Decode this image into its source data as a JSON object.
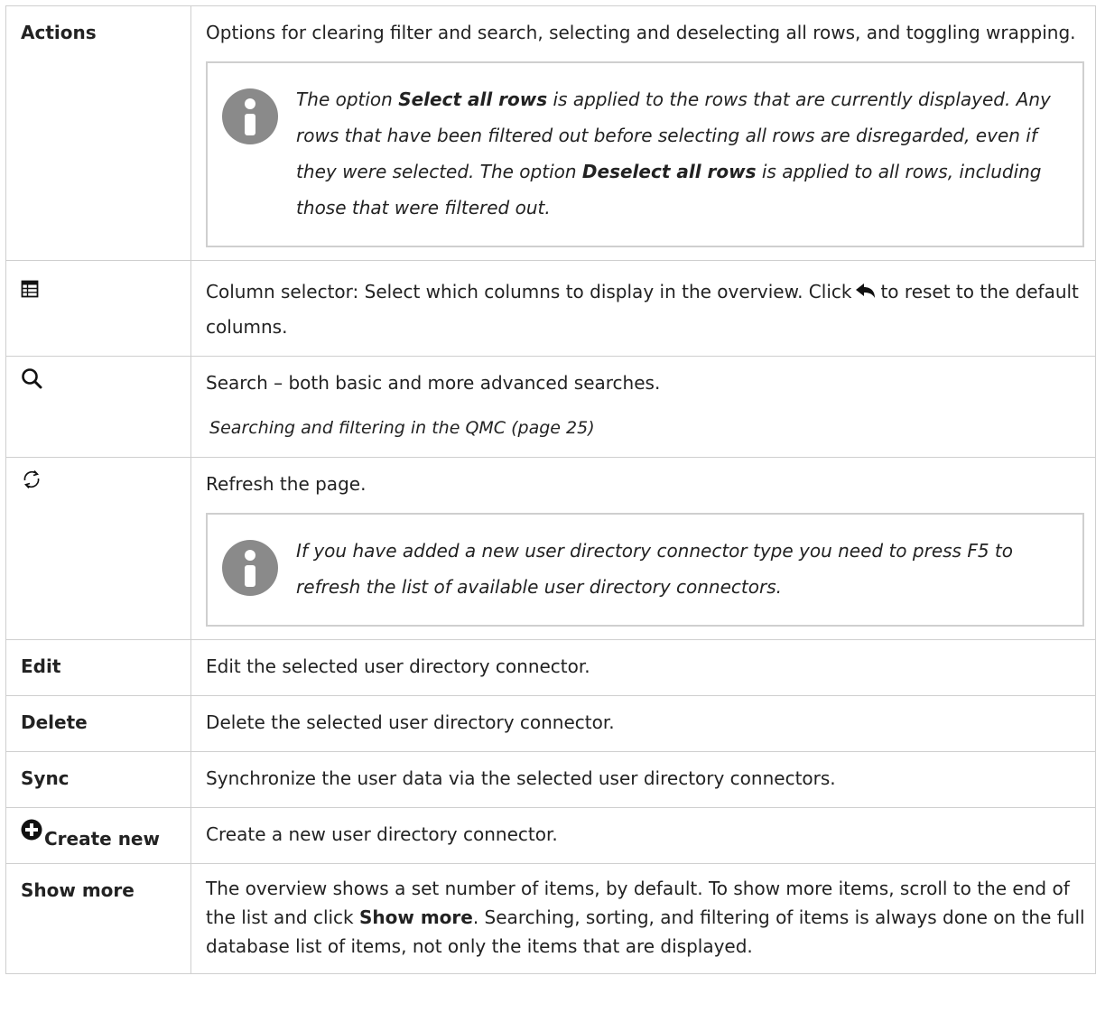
{
  "rows": {
    "actions": {
      "key": "Actions",
      "text": "Options for clearing filter and search, selecting and deselecting all rows, and toggling wrapping.",
      "note": {
        "p1": "The option ",
        "b1": "Select all rows",
        "p2": " is applied to the rows that are currently displayed. Any rows that have been filtered out before selecting all rows are disregarded, even if they were selected. The option ",
        "b2": "Deselect all rows",
        "p3": " is applied to all rows, including those that were filtered out."
      }
    },
    "columns": {
      "icon": "column-selector-icon",
      "text_before": "Column selector: Select which columns to display in the overview. Click",
      "reset_icon": "reset-arrow-icon",
      "text_after": "to reset to the default columns."
    },
    "search": {
      "icon": "search-icon",
      "text": "Search – both basic and more advanced searches.",
      "link": "Searching and filtering in the QMC (page 25)"
    },
    "refresh": {
      "icon": "refresh-icon",
      "text": "Refresh the page.",
      "note": "If you have added a new user directory connector type you need to press F5 to refresh the list of available user directory connectors."
    },
    "edit": {
      "key": "Edit",
      "text": "Edit the selected user directory connector."
    },
    "delete": {
      "key": "Delete",
      "text": "Delete the selected user directory connector."
    },
    "sync": {
      "key": "Sync",
      "text": "Synchronize the user data via the selected user directory connectors."
    },
    "create": {
      "icon": "plus-circle-icon",
      "key": "Create new",
      "text": "Create a new user directory connector."
    },
    "show_more": {
      "key": "Show more",
      "p1": "The overview shows a set number of items, by default. To show more items, scroll to the end of the list and click ",
      "b1": "Show more",
      "p2": ". Searching, sorting, and filtering of items is always done on the full database list of items, not only the items that are displayed."
    }
  },
  "colors": {
    "border": "#cfcfcf",
    "icon_gray": "#8a8a8a",
    "text": "#222222"
  }
}
